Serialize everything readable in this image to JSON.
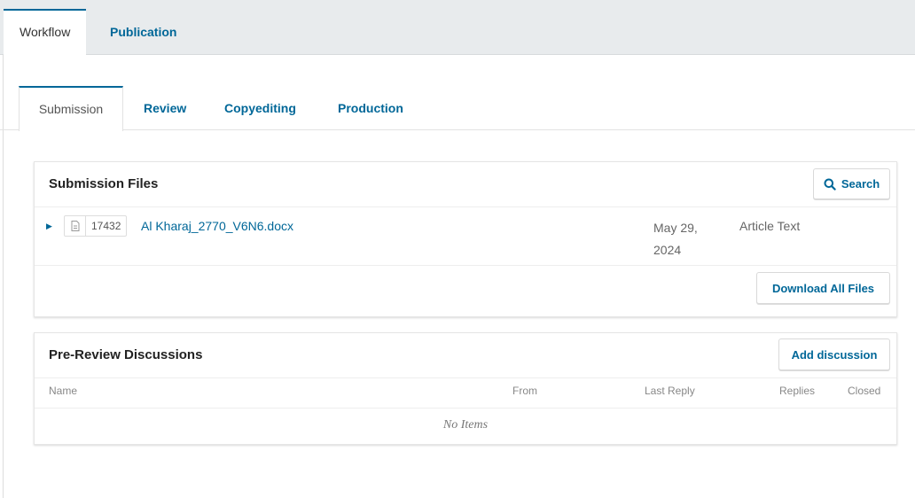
{
  "top_tabs": {
    "active": "Workflow",
    "other": "Publication"
  },
  "sub_tabs": {
    "active": "Submission",
    "items": [
      "Review",
      "Copyediting",
      "Production"
    ]
  },
  "submission_files": {
    "title": "Submission Files",
    "search_label": "Search",
    "file": {
      "id": "17432",
      "name": "Al Kharaj_2770_V6N6.docx",
      "date_line1": "May 29,",
      "date_line2": "2024",
      "type": "Article Text"
    },
    "download_label": "Download All Files"
  },
  "pre_review": {
    "title": "Pre-Review Discussions",
    "add_label": "Add discussion",
    "columns": [
      "Name",
      "From",
      "Last Reply",
      "Replies",
      "Closed"
    ],
    "empty": "No Items"
  },
  "colors": {
    "accent": "#006798",
    "topbar": "#e8ebed"
  }
}
